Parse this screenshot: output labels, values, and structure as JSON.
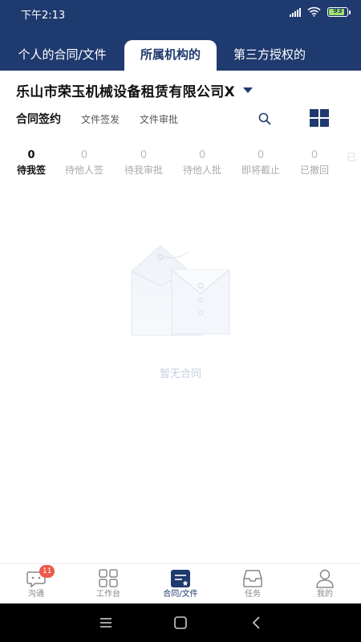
{
  "status_bar": {
    "time": "下午2:13",
    "battery_pct": "93",
    "battery_color": "#9fe06a"
  },
  "tabs": [
    {
      "label": "个人的合同/文件",
      "active": false
    },
    {
      "label": "所属机构的",
      "active": true
    },
    {
      "label": "第三方授权的",
      "active": false
    }
  ],
  "org": {
    "name": "乐山市荣玉机械设备租赁有限公司X"
  },
  "filters": [
    {
      "label": "合同签约",
      "active": true
    },
    {
      "label": "文件签发",
      "active": false
    },
    {
      "label": "文件审批",
      "active": false
    }
  ],
  "stats": [
    {
      "count": "0",
      "label": "待我签",
      "active": true
    },
    {
      "count": "0",
      "label": "待他人签",
      "active": false
    },
    {
      "count": "0",
      "label": "待我审批",
      "active": false
    },
    {
      "count": "0",
      "label": "待他人批",
      "active": false
    },
    {
      "count": "0",
      "label": "即将截止",
      "active": false
    },
    {
      "count": "0",
      "label": "已撤回",
      "active": false
    },
    {
      "count": "",
      "label": "已",
      "active": false
    }
  ],
  "empty": {
    "text": "暂无合同"
  },
  "bottom_nav": [
    {
      "label": "沟通",
      "icon": "chat-icon",
      "badge": "11",
      "active": false
    },
    {
      "label": "工作台",
      "icon": "grid-icon",
      "active": false
    },
    {
      "label": "合同/文件",
      "icon": "contract-icon",
      "active": true
    },
    {
      "label": "任务",
      "icon": "inbox-icon",
      "active": false
    },
    {
      "label": "我的",
      "icon": "user-icon",
      "active": false
    }
  ],
  "colors": {
    "primary": "#1f3a6e",
    "badge": "#ec5a4d",
    "muted": "#aaaaaa",
    "empty_text": "#c4d0e0"
  }
}
